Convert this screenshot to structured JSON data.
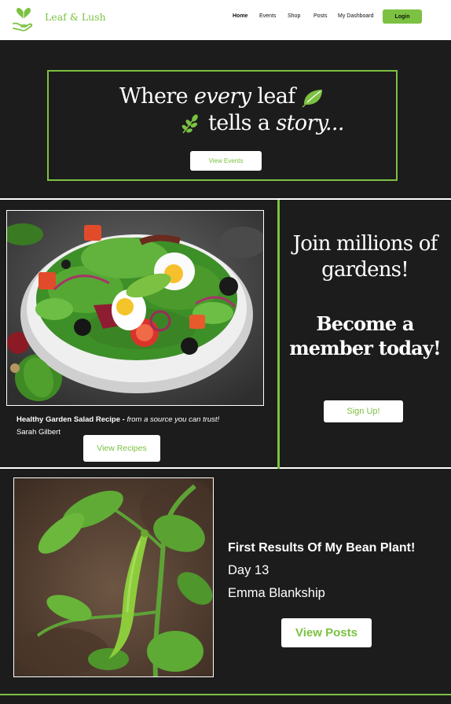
{
  "brand": {
    "name": "Leaf & Lush",
    "logo_icon": "heart-leaf-hand-icon",
    "accent": "#7cc142"
  },
  "nav": {
    "links": [
      "Home",
      "Events",
      "Shop",
      "Posts",
      "My Dashboard"
    ],
    "active": "Home",
    "login_label": "Login"
  },
  "hero": {
    "line1_a": "Where ",
    "line1_b": "every",
    "line1_c": " leaf",
    "line2_a": "tells a ",
    "line2_b": "story...",
    "button_label": "View Events"
  },
  "recipe": {
    "title": "Healthy Garden Salad Recipe - ",
    "tagline": "from a source you can trust!",
    "author": "Sarah Gilbert",
    "button_label": "View Recipes"
  },
  "membership": {
    "join_line1": "Join millions of",
    "join_line2": "gardens!",
    "become_line1": "Become a",
    "become_line2": "member today!",
    "button_label": "Sign Up!"
  },
  "post": {
    "title": "First Results Of My Bean Plant!",
    "day": "Day 13",
    "author": "Emma Blankship",
    "button_label": "View Posts"
  }
}
